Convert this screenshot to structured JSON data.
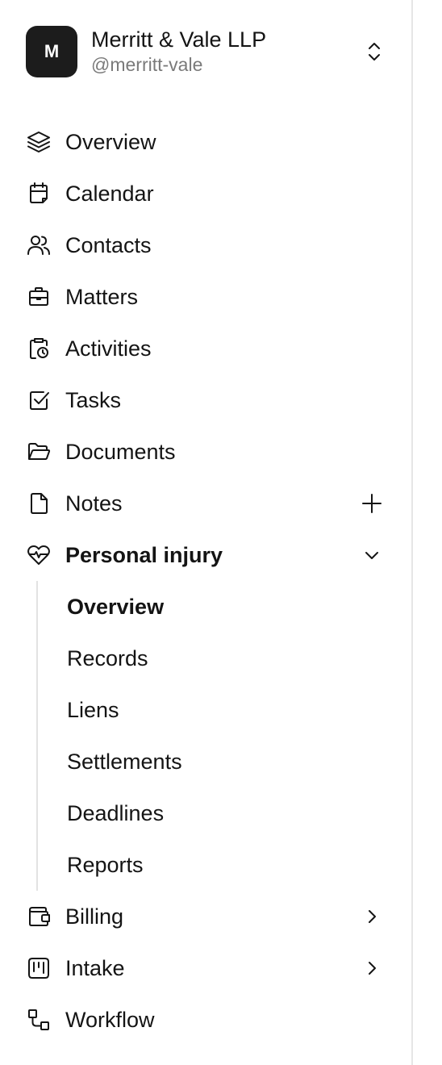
{
  "workspace": {
    "initial": "M",
    "name": "Merritt & Vale LLP",
    "handle": "@merritt-vale",
    "switcher_icon": "chevrons-up-down-icon"
  },
  "nav": {
    "items": [
      {
        "label": "Overview",
        "icon": "layers-icon"
      },
      {
        "label": "Calendar",
        "icon": "calendar-icon"
      },
      {
        "label": "Contacts",
        "icon": "users-icon"
      },
      {
        "label": "Matters",
        "icon": "briefcase-icon"
      },
      {
        "label": "Activities",
        "icon": "clipboard-clock-icon"
      },
      {
        "label": "Tasks",
        "icon": "checkbox-icon"
      },
      {
        "label": "Documents",
        "icon": "folder-open-icon"
      },
      {
        "label": "Notes",
        "icon": "note-icon",
        "trailing": "plus-icon"
      }
    ],
    "group": {
      "label": "Personal injury",
      "icon": "heart-pulse-icon",
      "expanded": true,
      "trailing": "chevron-down-icon",
      "children": [
        {
          "label": "Overview",
          "active": true
        },
        {
          "label": "Records",
          "active": false
        },
        {
          "label": "Liens",
          "active": false
        },
        {
          "label": "Settlements",
          "active": false
        },
        {
          "label": "Deadlines",
          "active": false
        },
        {
          "label": "Reports",
          "active": false
        }
      ]
    },
    "bottom_items": [
      {
        "label": "Billing",
        "icon": "wallet-icon",
        "trailing": "chevron-right-icon"
      },
      {
        "label": "Intake",
        "icon": "kanban-icon",
        "trailing": "chevron-right-icon"
      },
      {
        "label": "Workflow",
        "icon": "workflow-icon"
      }
    ]
  },
  "colors": {
    "text": "#141414",
    "muted": "#7a7a7a",
    "avatar_bg": "#1c1c1c",
    "border": "#e6e6e6"
  }
}
